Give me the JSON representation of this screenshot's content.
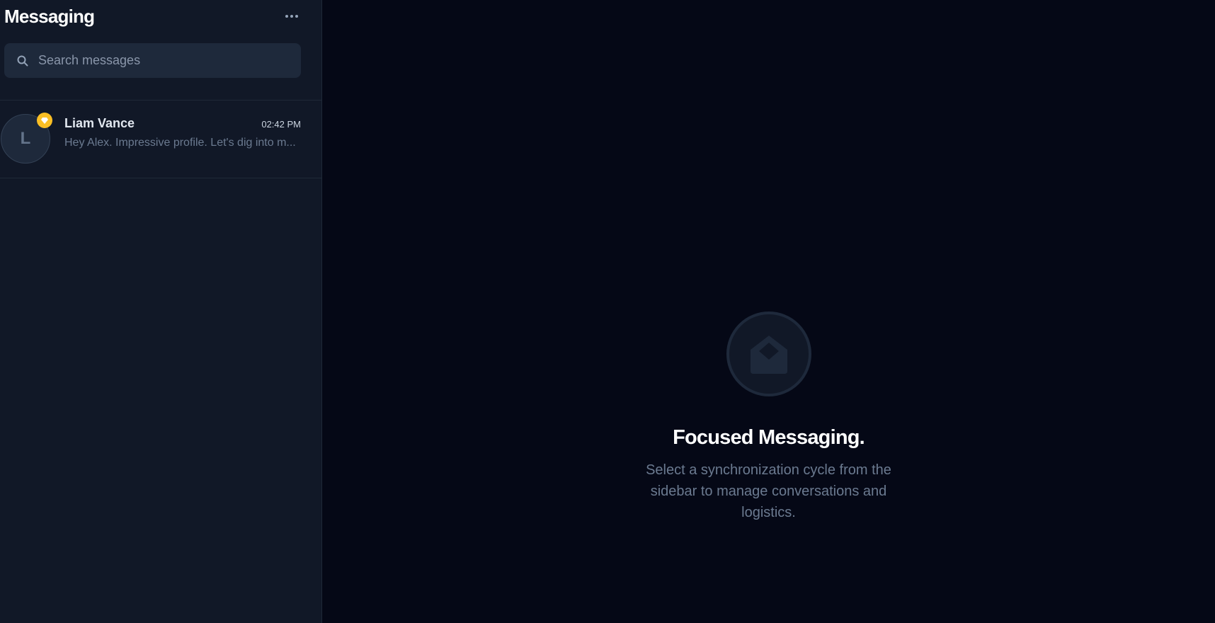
{
  "sidebar": {
    "title": "Messaging",
    "more_icon": "more-horizontal-icon",
    "search": {
      "placeholder": "Search messages",
      "value": "",
      "icon": "search-icon"
    },
    "conversations": [
      {
        "avatar_initial": "L",
        "name": "Liam Vance",
        "time": "02:42 PM",
        "preview": "Hey Alex. Impressive profile. Let's dig into m...",
        "badge_icon": "premium-gem-icon",
        "badge_color": "#fbbf24"
      }
    ]
  },
  "main": {
    "empty_state": {
      "icon": "open-envelope-icon",
      "title": "Focused Messaging.",
      "subtitle": "Select a synchronization cycle from the sidebar to manage conversations and logistics."
    }
  },
  "colors": {
    "background": "#050816",
    "sidebar": "#111827",
    "accent": "#fbbf24"
  }
}
